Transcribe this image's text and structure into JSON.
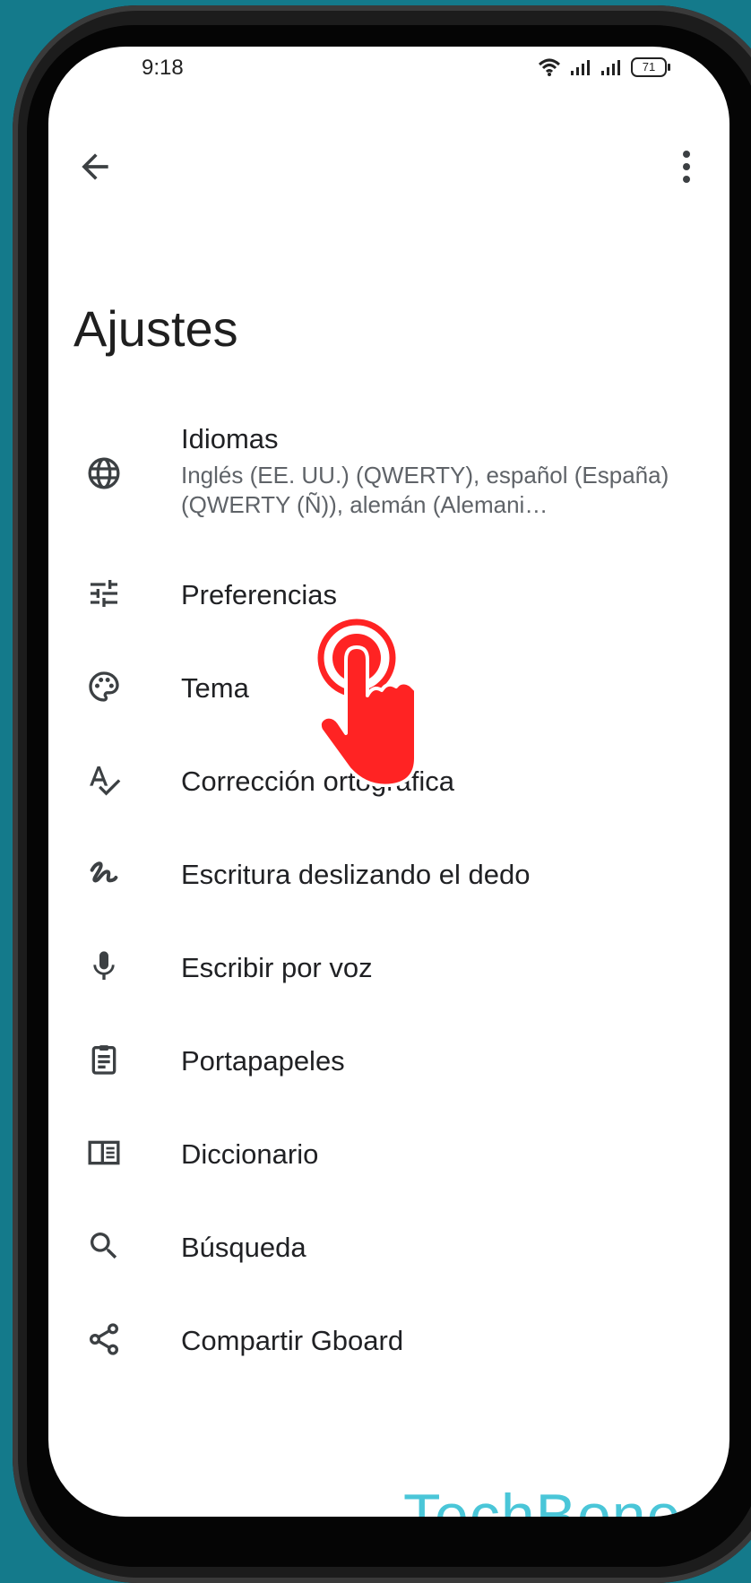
{
  "status_bar": {
    "time": "9:18",
    "battery": "71"
  },
  "page": {
    "title": "Ajustes"
  },
  "settings_items": [
    {
      "label": "Idiomas",
      "subtitle": "Inglés (EE. UU.) (QWERTY), español (España) (QWERTY (Ñ)), alemán (Alemani…",
      "icon": "globe-icon"
    },
    {
      "label": "Preferencias",
      "icon": "sliders-icon"
    },
    {
      "label": "Tema",
      "icon": "palette-icon"
    },
    {
      "label": "Corrección ortográfica",
      "icon": "spellcheck-icon"
    },
    {
      "label": "Escritura deslizando el dedo",
      "icon": "gesture-icon"
    },
    {
      "label": "Escribir por voz",
      "icon": "microphone-icon"
    },
    {
      "label": "Portapapeles",
      "icon": "clipboard-icon"
    },
    {
      "label": "Diccionario",
      "icon": "dictionary-icon"
    },
    {
      "label": "Búsqueda",
      "icon": "search-icon"
    },
    {
      "label": "Compartir Gboard",
      "icon": "share-icon"
    }
  ],
  "watermark": "TechBone",
  "colors": {
    "background": "#147a8b",
    "tap_indicator": "#ff2323",
    "watermark": "#4ac6d8"
  }
}
